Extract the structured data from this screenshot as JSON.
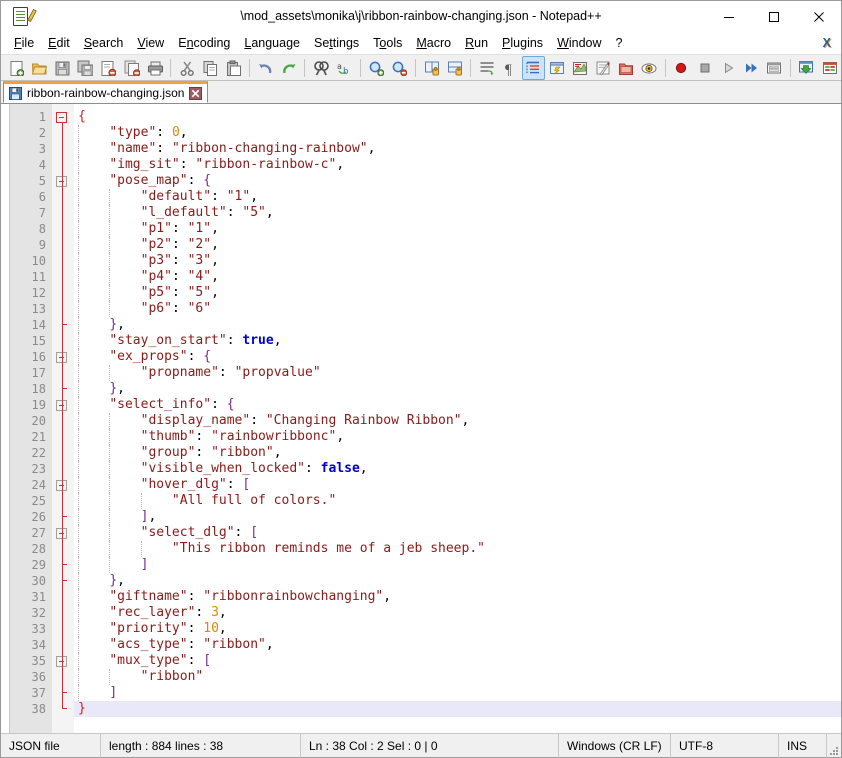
{
  "window": {
    "title": "\\mod_assets\\monika\\j\\ribbon-rainbow-changing.json - Notepad++",
    "app_icon": "notepad-plus-plus-icon",
    "controls": {
      "minimize": "minimize-icon",
      "maximize": "maximize-icon",
      "close": "close-icon"
    }
  },
  "menubar": {
    "items": [
      {
        "label": "File",
        "mnemonic": "F"
      },
      {
        "label": "Edit",
        "mnemonic": "E"
      },
      {
        "label": "Search",
        "mnemonic": "S"
      },
      {
        "label": "View",
        "mnemonic": "V"
      },
      {
        "label": "Encoding",
        "mnemonic": "n"
      },
      {
        "label": "Language",
        "mnemonic": "L"
      },
      {
        "label": "Settings",
        "mnemonic": "t"
      },
      {
        "label": "Tools",
        "mnemonic": "o"
      },
      {
        "label": "Macro",
        "mnemonic": "M"
      },
      {
        "label": "Run",
        "mnemonic": "R"
      },
      {
        "label": "Plugins",
        "mnemonic": "P"
      },
      {
        "label": "Window",
        "mnemonic": "W"
      },
      {
        "label": "?",
        "mnemonic": ""
      }
    ],
    "close_document_label": "X"
  },
  "toolbar": {
    "buttons": [
      {
        "name": "new-file-icon",
        "group": 0
      },
      {
        "name": "open-file-icon",
        "group": 0
      },
      {
        "name": "save-icon",
        "group": 0
      },
      {
        "name": "save-all-icon",
        "group": 0
      },
      {
        "name": "close-file-icon",
        "group": 0
      },
      {
        "name": "close-all-files-icon",
        "group": 0
      },
      {
        "name": "print-icon",
        "group": 0
      },
      {
        "name": "cut-icon",
        "group": 1
      },
      {
        "name": "copy-icon",
        "group": 1
      },
      {
        "name": "paste-icon",
        "group": 1
      },
      {
        "name": "undo-icon",
        "group": 2
      },
      {
        "name": "redo-icon",
        "group": 2
      },
      {
        "name": "find-icon",
        "group": 3
      },
      {
        "name": "replace-icon",
        "group": 3
      },
      {
        "name": "zoom-in-icon",
        "group": 4
      },
      {
        "name": "zoom-out-icon",
        "group": 4
      },
      {
        "name": "sync-vertical-icon",
        "group": 5
      },
      {
        "name": "sync-horizontal-icon",
        "group": 5
      },
      {
        "name": "word-wrap-icon",
        "group": 6
      },
      {
        "name": "show-all-chars-icon",
        "group": 6
      },
      {
        "name": "indent-guide-icon",
        "group": 6,
        "active": true
      },
      {
        "name": "user-defined-dialog-icon",
        "group": 6
      },
      {
        "name": "document-map-icon",
        "group": 6
      },
      {
        "name": "function-list-icon",
        "group": 6
      },
      {
        "name": "folder-as-workspace-icon",
        "group": 6
      },
      {
        "name": "monitoring-icon",
        "group": 6
      },
      {
        "name": "record-macro-icon",
        "group": 7
      },
      {
        "name": "stop-recording-icon",
        "group": 7
      },
      {
        "name": "play-macro-icon",
        "group": 7
      },
      {
        "name": "run-macro-multiple-icon",
        "group": 7
      },
      {
        "name": "save-macro-icon",
        "group": 7
      },
      {
        "name": "run-icon",
        "group": 8
      },
      {
        "name": "preferences-icon",
        "group": 8
      }
    ]
  },
  "tabs": [
    {
      "label": "ribbon-rainbow-changing.json",
      "save_icon": "floppy-disk-saved-icon",
      "close_icon": "tab-close-icon",
      "active": true
    }
  ],
  "editor": {
    "total_lines": 38,
    "current_line": 38,
    "lines": [
      {
        "n": 1,
        "indent": 0,
        "fold": "open-red",
        "tokens": [
          {
            "t": "brace",
            "v": "{"
          }
        ]
      },
      {
        "n": 2,
        "indent": 1,
        "tokens": [
          {
            "t": "key",
            "v": "\"type\""
          },
          {
            "t": "colon",
            "v": ": "
          },
          {
            "t": "num",
            "v": "0"
          },
          {
            "t": "colon",
            "v": ","
          }
        ]
      },
      {
        "n": 3,
        "indent": 1,
        "tokens": [
          {
            "t": "key",
            "v": "\"name\""
          },
          {
            "t": "colon",
            "v": ": "
          },
          {
            "t": "str",
            "v": "\"ribbon-changing-rainbow\""
          },
          {
            "t": "colon",
            "v": ","
          }
        ]
      },
      {
        "n": 4,
        "indent": 1,
        "tokens": [
          {
            "t": "key",
            "v": "\"img_sit\""
          },
          {
            "t": "colon",
            "v": ": "
          },
          {
            "t": "str",
            "v": "\"ribbon-rainbow-c\""
          },
          {
            "t": "colon",
            "v": ","
          }
        ]
      },
      {
        "n": 5,
        "indent": 1,
        "fold": "open-gray",
        "tokens": [
          {
            "t": "key",
            "v": "\"pose_map\""
          },
          {
            "t": "colon",
            "v": ": "
          },
          {
            "t": "punct",
            "v": "{"
          }
        ]
      },
      {
        "n": 6,
        "indent": 2,
        "tokens": [
          {
            "t": "key",
            "v": "\"default\""
          },
          {
            "t": "colon",
            "v": ": "
          },
          {
            "t": "str",
            "v": "\"1\""
          },
          {
            "t": "colon",
            "v": ","
          }
        ]
      },
      {
        "n": 7,
        "indent": 2,
        "tokens": [
          {
            "t": "key",
            "v": "\"l_default\""
          },
          {
            "t": "colon",
            "v": ": "
          },
          {
            "t": "str",
            "v": "\"5\""
          },
          {
            "t": "colon",
            "v": ","
          }
        ]
      },
      {
        "n": 8,
        "indent": 2,
        "tokens": [
          {
            "t": "key",
            "v": "\"p1\""
          },
          {
            "t": "colon",
            "v": ": "
          },
          {
            "t": "str",
            "v": "\"1\""
          },
          {
            "t": "colon",
            "v": ","
          }
        ]
      },
      {
        "n": 9,
        "indent": 2,
        "tokens": [
          {
            "t": "key",
            "v": "\"p2\""
          },
          {
            "t": "colon",
            "v": ": "
          },
          {
            "t": "str",
            "v": "\"2\""
          },
          {
            "t": "colon",
            "v": ","
          }
        ]
      },
      {
        "n": 10,
        "indent": 2,
        "tokens": [
          {
            "t": "key",
            "v": "\"p3\""
          },
          {
            "t": "colon",
            "v": ": "
          },
          {
            "t": "str",
            "v": "\"3\""
          },
          {
            "t": "colon",
            "v": ","
          }
        ]
      },
      {
        "n": 11,
        "indent": 2,
        "tokens": [
          {
            "t": "key",
            "v": "\"p4\""
          },
          {
            "t": "colon",
            "v": ": "
          },
          {
            "t": "str",
            "v": "\"4\""
          },
          {
            "t": "colon",
            "v": ","
          }
        ]
      },
      {
        "n": 12,
        "indent": 2,
        "tokens": [
          {
            "t": "key",
            "v": "\"p5\""
          },
          {
            "t": "colon",
            "v": ": "
          },
          {
            "t": "str",
            "v": "\"5\""
          },
          {
            "t": "colon",
            "v": ","
          }
        ]
      },
      {
        "n": 13,
        "indent": 2,
        "tokens": [
          {
            "t": "key",
            "v": "\"p6\""
          },
          {
            "t": "colon",
            "v": ": "
          },
          {
            "t": "str",
            "v": "\"6\""
          }
        ]
      },
      {
        "n": 14,
        "indent": 1,
        "fold": "tick",
        "tokens": [
          {
            "t": "punct",
            "v": "}"
          },
          {
            "t": "colon",
            "v": ","
          }
        ]
      },
      {
        "n": 15,
        "indent": 1,
        "tokens": [
          {
            "t": "key",
            "v": "\"stay_on_start\""
          },
          {
            "t": "colon",
            "v": ": "
          },
          {
            "t": "bool",
            "v": "true"
          },
          {
            "t": "colon",
            "v": ","
          }
        ]
      },
      {
        "n": 16,
        "indent": 1,
        "fold": "open-gray",
        "tokens": [
          {
            "t": "key",
            "v": "\"ex_props\""
          },
          {
            "t": "colon",
            "v": ": "
          },
          {
            "t": "punct",
            "v": "{"
          }
        ]
      },
      {
        "n": 17,
        "indent": 2,
        "tokens": [
          {
            "t": "key",
            "v": "\"propname\""
          },
          {
            "t": "colon",
            "v": ": "
          },
          {
            "t": "str",
            "v": "\"propvalue\""
          }
        ]
      },
      {
        "n": 18,
        "indent": 1,
        "fold": "tick",
        "tokens": [
          {
            "t": "punct",
            "v": "}"
          },
          {
            "t": "colon",
            "v": ","
          }
        ]
      },
      {
        "n": 19,
        "indent": 1,
        "fold": "open-gray",
        "tokens": [
          {
            "t": "key",
            "v": "\"select_info\""
          },
          {
            "t": "colon",
            "v": ": "
          },
          {
            "t": "punct",
            "v": "{"
          }
        ]
      },
      {
        "n": 20,
        "indent": 2,
        "tokens": [
          {
            "t": "key",
            "v": "\"display_name\""
          },
          {
            "t": "colon",
            "v": ": "
          },
          {
            "t": "str",
            "v": "\"Changing Rainbow Ribbon\""
          },
          {
            "t": "colon",
            "v": ","
          }
        ]
      },
      {
        "n": 21,
        "indent": 2,
        "tokens": [
          {
            "t": "key",
            "v": "\"thumb\""
          },
          {
            "t": "colon",
            "v": ": "
          },
          {
            "t": "str",
            "v": "\"rainbowribbonc\""
          },
          {
            "t": "colon",
            "v": ","
          }
        ]
      },
      {
        "n": 22,
        "indent": 2,
        "tokens": [
          {
            "t": "key",
            "v": "\"group\""
          },
          {
            "t": "colon",
            "v": ": "
          },
          {
            "t": "str",
            "v": "\"ribbon\""
          },
          {
            "t": "colon",
            "v": ","
          }
        ]
      },
      {
        "n": 23,
        "indent": 2,
        "tokens": [
          {
            "t": "key",
            "v": "\"visible_when_locked\""
          },
          {
            "t": "colon",
            "v": ": "
          },
          {
            "t": "bool",
            "v": "false"
          },
          {
            "t": "colon",
            "v": ","
          }
        ]
      },
      {
        "n": 24,
        "indent": 2,
        "fold": "open-gray",
        "tokens": [
          {
            "t": "key",
            "v": "\"hover_dlg\""
          },
          {
            "t": "colon",
            "v": ": "
          },
          {
            "t": "punct",
            "v": "["
          }
        ]
      },
      {
        "n": 25,
        "indent": 3,
        "tokens": [
          {
            "t": "str",
            "v": "\"All full of colors.\""
          }
        ]
      },
      {
        "n": 26,
        "indent": 2,
        "fold": "tick",
        "tokens": [
          {
            "t": "punct",
            "v": "]"
          },
          {
            "t": "colon",
            "v": ","
          }
        ]
      },
      {
        "n": 27,
        "indent": 2,
        "fold": "open-gray",
        "tokens": [
          {
            "t": "key",
            "v": "\"select_dlg\""
          },
          {
            "t": "colon",
            "v": ": "
          },
          {
            "t": "punct",
            "v": "["
          }
        ]
      },
      {
        "n": 28,
        "indent": 3,
        "tokens": [
          {
            "t": "str",
            "v": "\"This ribbon reminds me of a jeb sheep.\""
          }
        ]
      },
      {
        "n": 29,
        "indent": 2,
        "fold": "tick",
        "tokens": [
          {
            "t": "punct",
            "v": "]"
          }
        ]
      },
      {
        "n": 30,
        "indent": 1,
        "fold": "tick",
        "tokens": [
          {
            "t": "punct",
            "v": "}"
          },
          {
            "t": "colon",
            "v": ","
          }
        ]
      },
      {
        "n": 31,
        "indent": 1,
        "tokens": [
          {
            "t": "key",
            "v": "\"giftname\""
          },
          {
            "t": "colon",
            "v": ": "
          },
          {
            "t": "str",
            "v": "\"ribbonrainbowchanging\""
          },
          {
            "t": "colon",
            "v": ","
          }
        ]
      },
      {
        "n": 32,
        "indent": 1,
        "tokens": [
          {
            "t": "key",
            "v": "\"rec_layer\""
          },
          {
            "t": "colon",
            "v": ": "
          },
          {
            "t": "num",
            "v": "3"
          },
          {
            "t": "colon",
            "v": ","
          }
        ]
      },
      {
        "n": 33,
        "indent": 1,
        "tokens": [
          {
            "t": "key",
            "v": "\"priority\""
          },
          {
            "t": "colon",
            "v": ": "
          },
          {
            "t": "num",
            "v": "10"
          },
          {
            "t": "colon",
            "v": ","
          }
        ]
      },
      {
        "n": 34,
        "indent": 1,
        "tokens": [
          {
            "t": "key",
            "v": "\"acs_type\""
          },
          {
            "t": "colon",
            "v": ": "
          },
          {
            "t": "str",
            "v": "\"ribbon\""
          },
          {
            "t": "colon",
            "v": ","
          }
        ]
      },
      {
        "n": 35,
        "indent": 1,
        "fold": "open-gray",
        "tokens": [
          {
            "t": "key",
            "v": "\"mux_type\""
          },
          {
            "t": "colon",
            "v": ": "
          },
          {
            "t": "punct",
            "v": "["
          }
        ]
      },
      {
        "n": 36,
        "indent": 2,
        "tokens": [
          {
            "t": "str",
            "v": "\"ribbon\""
          }
        ]
      },
      {
        "n": 37,
        "indent": 1,
        "fold": "tick",
        "tokens": [
          {
            "t": "punct",
            "v": "]"
          }
        ]
      },
      {
        "n": 38,
        "indent": 0,
        "fold": "corner",
        "current": true,
        "tokens": [
          {
            "t": "brace",
            "v": "}"
          }
        ]
      }
    ]
  },
  "statusbar": {
    "file_type": "JSON file",
    "length_lines": "length : 884   lines : 38",
    "position": "Ln : 38   Col : 2   Sel : 0 | 0",
    "eol": "Windows (CR LF)",
    "encoding": "UTF-8",
    "insert_mode": "INS"
  },
  "colors": {
    "tab_accent": "#f2a13a",
    "key": "#8b1a1a",
    "string": "#8b1a1a",
    "number": "#e08a00",
    "boolean": "#0000d0",
    "bracket": "#7a2a8a",
    "root_brace": "#d02020",
    "current_line": "#e8e8f8",
    "linenum_bg": "#e4e4e4",
    "fold_line": "#d03030"
  }
}
